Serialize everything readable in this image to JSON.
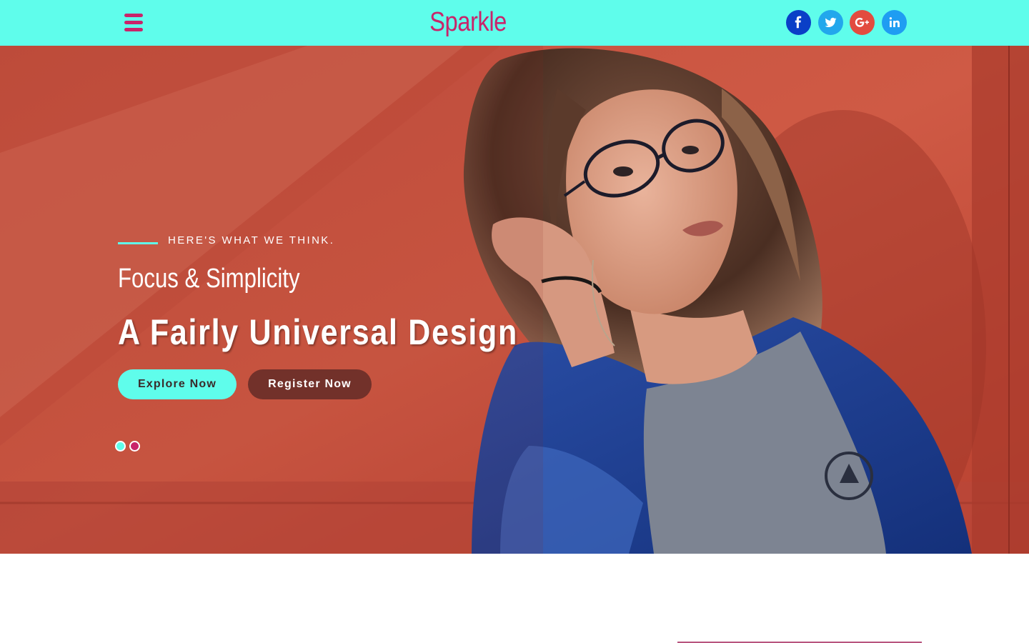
{
  "header": {
    "logo": "Sparkle",
    "menu_icon": "hamburger-menu-icon",
    "social": [
      {
        "name": "facebook",
        "icon": "facebook-icon",
        "color": "#0a3fc7"
      },
      {
        "name": "twitter",
        "icon": "twitter-icon",
        "color": "#22a7ec"
      },
      {
        "name": "google-plus",
        "icon": "google-plus-icon",
        "color": "#e24c3f"
      },
      {
        "name": "linkedin",
        "icon": "linkedin-icon",
        "color": "#1f9df2"
      }
    ],
    "background_color": "#5ffdeb",
    "accent_color": "#c9246a"
  },
  "hero": {
    "eyebrow": "HERE'S WHAT WE THINK.",
    "subtitle": "Focus & Simplicity",
    "headline": "A Fairly Universal Design",
    "buttons": {
      "explore_label": "Explore Now",
      "register_label": "Register Now"
    },
    "slides": [
      {
        "active": true
      },
      {
        "active": false
      }
    ]
  }
}
